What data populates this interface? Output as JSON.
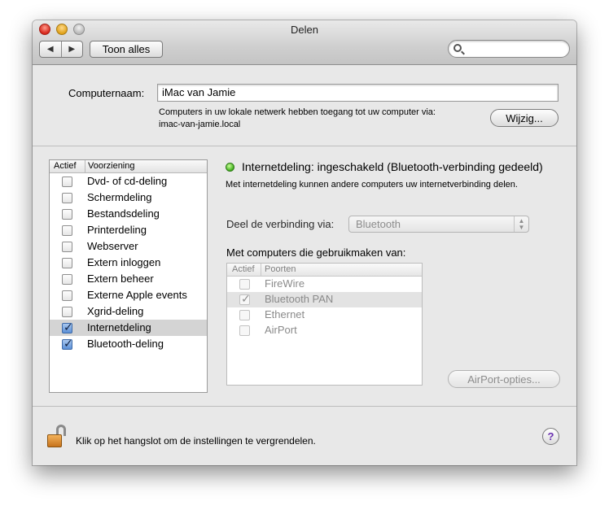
{
  "window": {
    "title": "Delen"
  },
  "toolbar": {
    "back_icon": "◀",
    "forward_icon": "▶",
    "show_all_label": "Toon alles",
    "search_value": ""
  },
  "computer": {
    "name_label": "Computernaam:",
    "name_value": "iMac van Jamie",
    "info_line1": "Computers in uw lokale netwerk hebben toegang tot uw computer via:",
    "info_line2": "imac-van-jamie.local",
    "edit_button": "Wijzig..."
  },
  "services": {
    "header_active": "Actief",
    "header_service": "Voorziening",
    "items": [
      {
        "label": "Dvd- of cd-deling",
        "checked": false
      },
      {
        "label": "Schermdeling",
        "checked": false
      },
      {
        "label": "Bestandsdeling",
        "checked": false
      },
      {
        "label": "Printerdeling",
        "checked": false
      },
      {
        "label": "Webserver",
        "checked": false
      },
      {
        "label": "Extern inloggen",
        "checked": false
      },
      {
        "label": "Extern beheer",
        "checked": false
      },
      {
        "label": "Externe Apple events",
        "checked": false
      },
      {
        "label": "Xgrid-deling",
        "checked": false
      },
      {
        "label": "Internetdeling",
        "checked": true,
        "selected": true
      },
      {
        "label": "Bluetooth-deling",
        "checked": true
      }
    ]
  },
  "detail": {
    "status_title": "Internetdeling: ingeschakeld (Bluetooth-verbinding gedeeld)",
    "status_desc": "Met internetdeling kunnen andere computers uw internetverbinding delen.",
    "share_via_label": "Deel de verbinding via:",
    "share_via_value": "Bluetooth",
    "ports_label": "Met computers die gebruikmaken van:",
    "ports_header_active": "Actief",
    "ports_header_ports": "Poorten",
    "ports": [
      {
        "label": "FireWire",
        "checked": false
      },
      {
        "label": "Bluetooth PAN",
        "checked": true,
        "selected": true
      },
      {
        "label": "Ethernet",
        "checked": false
      },
      {
        "label": "AirPort",
        "checked": false
      }
    ],
    "airport_button": "AirPort-opties..."
  },
  "footer": {
    "lock_text": "Klik op het hangslot om de instellingen te vergrendelen.",
    "help_label": "?"
  },
  "colors": {
    "status_dot": "#3fae1c",
    "checkbox_checked": "#5b8fd6",
    "help_glyph": "#6a2fb0",
    "lock": "#c7731c"
  }
}
